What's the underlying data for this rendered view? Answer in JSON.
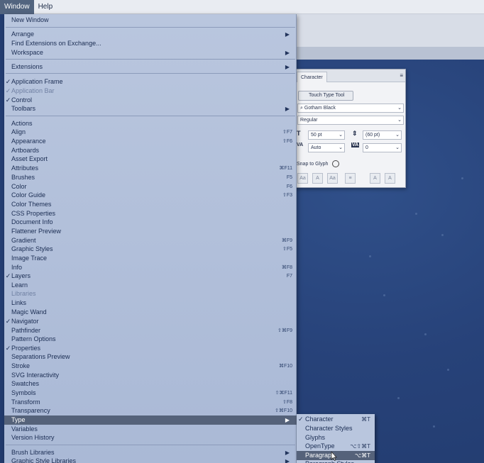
{
  "menubar": {
    "items": [
      "Window",
      "Help"
    ]
  },
  "window_menu": {
    "rows": [
      {
        "label": "New Window"
      },
      {
        "label": "Arrange",
        "submenu": true
      },
      {
        "label": "Find Extensions on Exchange..."
      },
      {
        "label": "Workspace",
        "submenu": true
      },
      {
        "label": "Extensions",
        "submenu": true
      },
      {
        "label": "Application Frame",
        "checked": true
      },
      {
        "label": "Application Bar",
        "checked": true,
        "disabled": true
      },
      {
        "label": "Control",
        "checked": true
      },
      {
        "label": "Toolbars",
        "submenu": true
      },
      {
        "label": "Actions"
      },
      {
        "label": "Align",
        "shortcut": "⇧F7"
      },
      {
        "label": "Appearance",
        "shortcut": "⇧F6"
      },
      {
        "label": "Artboards"
      },
      {
        "label": "Asset Export"
      },
      {
        "label": "Attributes",
        "shortcut": "⌘F11"
      },
      {
        "label": "Brushes",
        "shortcut": "F5"
      },
      {
        "label": "Color",
        "shortcut": "F6"
      },
      {
        "label": "Color Guide",
        "shortcut": "⇧F3"
      },
      {
        "label": "Color Themes"
      },
      {
        "label": "CSS Properties"
      },
      {
        "label": "Document Info"
      },
      {
        "label": "Flattener Preview"
      },
      {
        "label": "Gradient",
        "shortcut": "⌘F9"
      },
      {
        "label": "Graphic Styles",
        "shortcut": "⇧F5"
      },
      {
        "label": "Image Trace"
      },
      {
        "label": "Info",
        "shortcut": "⌘F8"
      },
      {
        "label": "Layers",
        "checked": true,
        "shortcut": "F7"
      },
      {
        "label": "Learn"
      },
      {
        "label": "Libraries",
        "disabled": true
      },
      {
        "label": "Links"
      },
      {
        "label": "Magic Wand"
      },
      {
        "label": "Navigator",
        "checked": true
      },
      {
        "label": "Pathfinder",
        "shortcut": "⇧⌘F9"
      },
      {
        "label": "Pattern Options"
      },
      {
        "label": "Properties",
        "checked": true
      },
      {
        "label": "Separations Preview"
      },
      {
        "label": "Stroke",
        "shortcut": "⌘F10"
      },
      {
        "label": "SVG Interactivity"
      },
      {
        "label": "Swatches"
      },
      {
        "label": "Symbols",
        "shortcut": "⇧⌘F11"
      },
      {
        "label": "Transform",
        "shortcut": "⇧F8"
      },
      {
        "label": "Transparency",
        "shortcut": "⇧⌘F10"
      },
      {
        "label": "Type",
        "submenu": true,
        "highlight": true
      },
      {
        "label": "Variables"
      },
      {
        "label": "Version History"
      },
      {
        "label": "Brush Libraries",
        "submenu": true
      },
      {
        "label": "Graphic Style Libraries",
        "submenu": true
      }
    ]
  },
  "type_submenu": {
    "rows": [
      {
        "label": "Character",
        "checked": true,
        "shortcut": "⌘T"
      },
      {
        "label": "Character Styles"
      },
      {
        "label": "Glyphs"
      },
      {
        "label": "OpenType",
        "shortcut": "⌥⇧⌘T"
      },
      {
        "label": "Paragraph",
        "shortcut": "⌥⌘T",
        "highlight": true
      },
      {
        "label": "Paragraph Styles"
      }
    ]
  },
  "character_panel": {
    "tab": "Character",
    "touch_type_tool": "Touch Type Tool",
    "font_family": "Gotham Black",
    "font_style": "Regular",
    "font_size": "50 pt",
    "leading": "(60 pt)",
    "kerning": "Auto",
    "tracking": "0",
    "snap_to_glyph": "Snap to Glyph"
  },
  "icons": {
    "check": "checkmark-icon",
    "submenu_arrow": "triangle-right-icon",
    "panel_menu": "hamburger-icon"
  },
  "colors": {
    "menu_bg": "#b9c6de",
    "highlight": "#55627a",
    "canvas": "#28457a"
  }
}
